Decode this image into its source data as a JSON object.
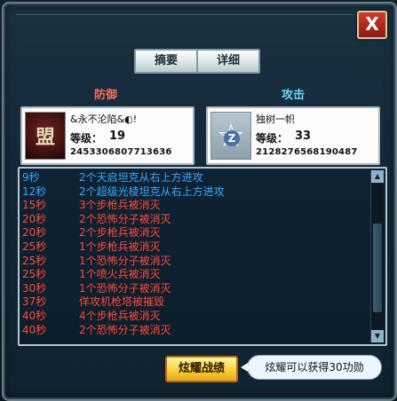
{
  "window": {
    "close_glyph": "X"
  },
  "tabs": {
    "summary": "摘要",
    "detail": "详细"
  },
  "sides": {
    "defense": "防御",
    "attack": "攻击"
  },
  "defender": {
    "name": "&永不沦陷&◐!",
    "level_label": "等级：",
    "level": "19",
    "id": "2453306807713636",
    "avatar_glyph": "盟"
  },
  "attacker": {
    "name": "独树一帜",
    "level_label": "等级：",
    "level": "33",
    "id": "2128276568190487",
    "avatar_glyph": "☆",
    "avatar_mark": "Z"
  },
  "log": [
    {
      "time": "9秒",
      "text": "2个天启坦克从右上方进攻",
      "color": "blue"
    },
    {
      "time": "12秒",
      "text": "2个超级光棱坦克从右上方进攻",
      "color": "blue"
    },
    {
      "time": "15秒",
      "text": "3个步枪兵被消灭",
      "color": "red"
    },
    {
      "time": "20秒",
      "text": "2个恐怖分子被消灭",
      "color": "red"
    },
    {
      "time": "20秒",
      "text": "2个步枪兵被消灭",
      "color": "red"
    },
    {
      "time": "25秒",
      "text": "1个步枪兵被消灭",
      "color": "red"
    },
    {
      "time": "25秒",
      "text": "1个恐怖分子被消灭",
      "color": "red"
    },
    {
      "time": "25秒",
      "text": "1个喷火兵被消灭",
      "color": "red"
    },
    {
      "time": "30秒",
      "text": "1个恐怖分子被消灭",
      "color": "red"
    },
    {
      "time": "37秒",
      "text": "佯攻机枪塔被摧毁",
      "color": "red"
    },
    {
      "time": "40秒",
      "text": "4个步枪兵被消灭",
      "color": "red"
    },
    {
      "time": "40秒",
      "text": "2个恐怖分子被消灭",
      "color": "red"
    }
  ],
  "actions": {
    "brag": "炫耀战绩",
    "brag_tip": "炫耀可以获得30功勋"
  },
  "colors": {
    "log_blue": "#39a7ff",
    "log_red": "#ff4a3a",
    "defense": "#f07060",
    "attack": "#6ad4f2"
  }
}
